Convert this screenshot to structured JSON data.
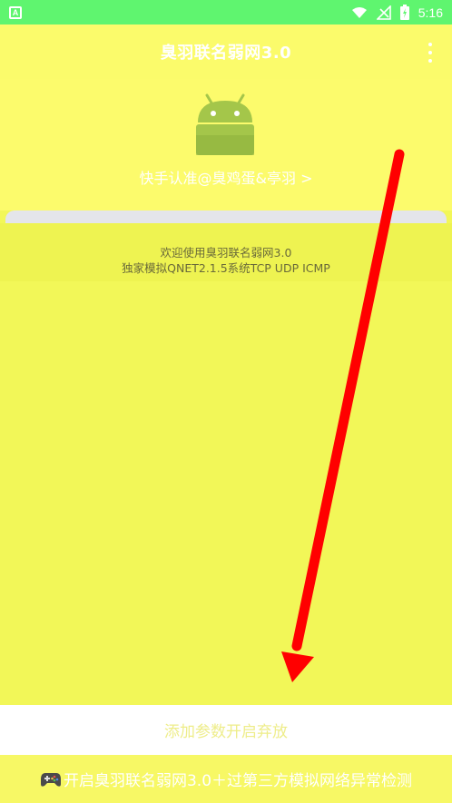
{
  "status_bar": {
    "notification_icon": "app-notification-icon",
    "icons": [
      "wifi-icon",
      "signal-icon",
      "battery-icon"
    ],
    "time": "5:16"
  },
  "toolbar": {
    "title": "臭羽联名弱网3.0",
    "menu_icon": "more-vert-icon"
  },
  "header": {
    "logo_icon": "android-icon",
    "link_text": "快手认准@臭鸡蛋&亭羽 >"
  },
  "welcome": {
    "line1": "欢迎使用臭羽联名弱网3.0",
    "line2": "独家模拟QNET2.1.5系统TCP UDP ICMP"
  },
  "buttons": {
    "add_params": "添加参数开启弃放",
    "start": "开启臭羽联名弱网3.0＋过第三方模拟网络异常检测",
    "start_icon": "gamepad-icon"
  },
  "colors": {
    "status_bar": "#5ff56f",
    "toolbar": "#fbfb6b",
    "card": "#f2f758",
    "arrow": "#ff0000"
  }
}
